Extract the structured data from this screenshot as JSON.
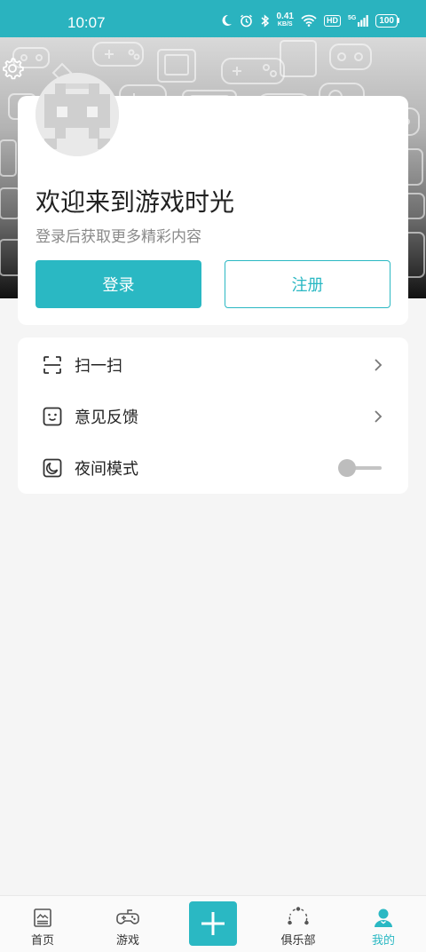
{
  "status_bar": {
    "time": "10:07",
    "net_speed_value": "0.41",
    "net_speed_unit": "KB/S",
    "hd_label": "HD",
    "network_label": "5G",
    "battery": "100"
  },
  "header": {
    "settings_icon": "gear-icon",
    "background": "game-controllers-pattern"
  },
  "profile": {
    "title": "欢迎来到游戏时光",
    "subtitle": "登录后获取更多精彩内容",
    "login_label": "登录",
    "register_label": "注册"
  },
  "menu": {
    "items": [
      {
        "label": "扫一扫",
        "icon": "scan-icon"
      },
      {
        "label": "意见反馈",
        "icon": "feedback-face-icon"
      },
      {
        "label": "夜间模式",
        "icon": "night-mode-icon",
        "toggle_on": false
      }
    ]
  },
  "nav": {
    "items": [
      {
        "label": "首页",
        "icon": "home-news-icon",
        "active": false
      },
      {
        "label": "游戏",
        "icon": "gamepad-icon",
        "active": false
      },
      {
        "label": "俱乐部",
        "icon": "club-icon",
        "active": false
      },
      {
        "label": "我的",
        "icon": "user-icon",
        "active": true
      }
    ],
    "plus_icon": "plus-icon"
  },
  "colors": {
    "accent": "#2ab8c3",
    "status_bar": "#2ab3bf"
  }
}
